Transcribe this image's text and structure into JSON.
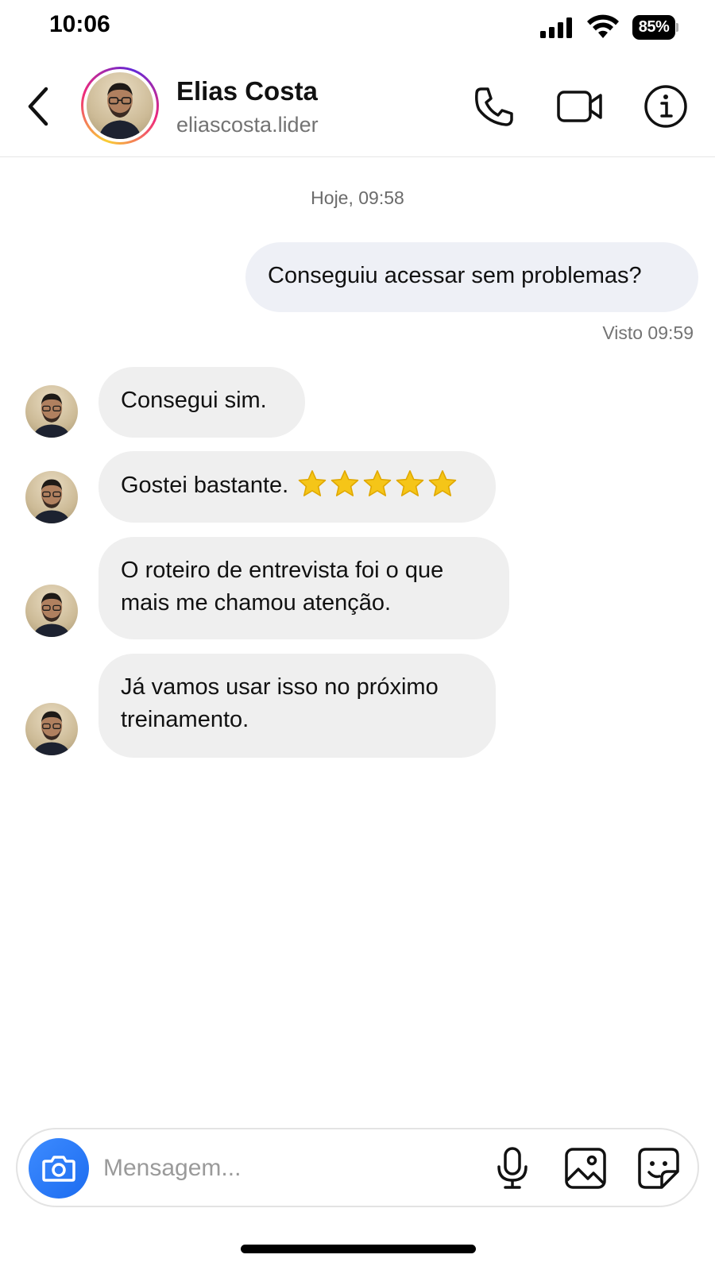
{
  "status_bar": {
    "time": "10:06",
    "battery_percent": "85%",
    "signal_icon": "cellular-signal-icon",
    "wifi_icon": "wifi-icon"
  },
  "header": {
    "back_icon": "chevron-left-icon",
    "contact_name": "Elias Costa",
    "contact_handle": "eliascosta.lider",
    "call_icon": "phone-icon",
    "video_icon": "video-camera-icon",
    "info_icon": "info-icon"
  },
  "chat": {
    "date_separator": "Hoje, 09:58",
    "outgoing": [
      {
        "text": "Conseguiu acessar sem problemas?"
      }
    ],
    "seen_status": "Visto 09:59",
    "incoming": [
      {
        "text": "Consegui sim."
      },
      {
        "text": "Gostei bastante.",
        "rating_stars": 5
      },
      {
        "text": "O roteiro de entrevista foi o que mais me chamou atenção."
      },
      {
        "text": "Já vamos usar isso no próximo treinamento."
      }
    ]
  },
  "composer": {
    "placeholder": "Mensagem...",
    "value": "",
    "camera_icon": "camera-icon",
    "mic_icon": "microphone-icon",
    "gallery_icon": "image-icon",
    "sticker_icon": "sticker-icon"
  },
  "colors": {
    "accent_blue": "#1c6cf0",
    "outgoing_bubble": "#eef0f6",
    "incoming_bubble": "#efefef",
    "muted_text": "#737373",
    "star": "#f5c518"
  }
}
